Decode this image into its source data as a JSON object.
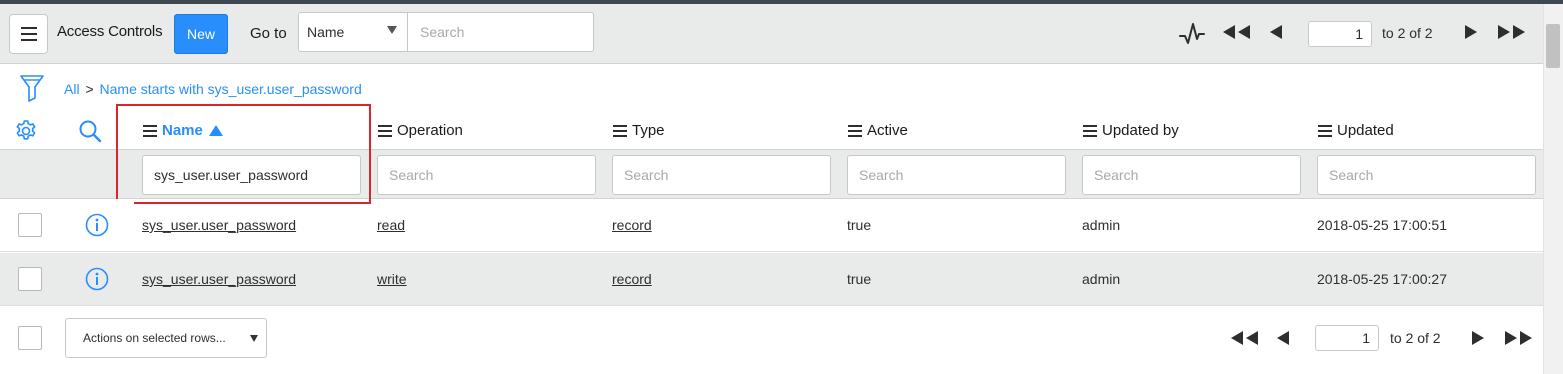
{
  "toolbar": {
    "title": "Access Controls",
    "new_label": "New",
    "goto_label": "Go to",
    "goto_field": "Name",
    "goto_placeholder": "Search",
    "page_number": "1",
    "page_of": "to 2 of 2"
  },
  "breadcrumb": {
    "all": "All",
    "separator": ">",
    "condition": "Name starts with sys_user.user_password"
  },
  "columns": [
    {
      "label": "Name",
      "sorted": "ascending",
      "search_value": "sys_user.user_password"
    },
    {
      "label": "Operation",
      "search_placeholder": "Search"
    },
    {
      "label": "Type",
      "search_placeholder": "Search"
    },
    {
      "label": "Active",
      "search_placeholder": "Search"
    },
    {
      "label": "Updated by",
      "search_placeholder": "Search"
    },
    {
      "label": "Updated",
      "search_placeholder": "Search"
    }
  ],
  "rows": [
    {
      "name": "sys_user.user_password",
      "operation": "read",
      "type": "record",
      "active": "true",
      "updated_by": "admin",
      "updated": "2018-05-25 17:00:51"
    },
    {
      "name": "sys_user.user_password",
      "operation": "write",
      "type": "record",
      "active": "true",
      "updated_by": "admin",
      "updated": "2018-05-25 17:00:27"
    }
  ],
  "footer": {
    "actions_label": "Actions on selected rows...",
    "page_number": "1",
    "page_of": "to 2 of 2"
  },
  "colors": {
    "accent": "#278efc",
    "highlight": "#d8252f",
    "toolbar_bg": "#e9eaea"
  },
  "icons": [
    "menu-icon",
    "activity-icon",
    "first-page-icon",
    "prev-page-icon",
    "next-page-icon",
    "last-page-icon",
    "filter-icon",
    "gear-icon",
    "search-icon",
    "info-icon"
  ]
}
